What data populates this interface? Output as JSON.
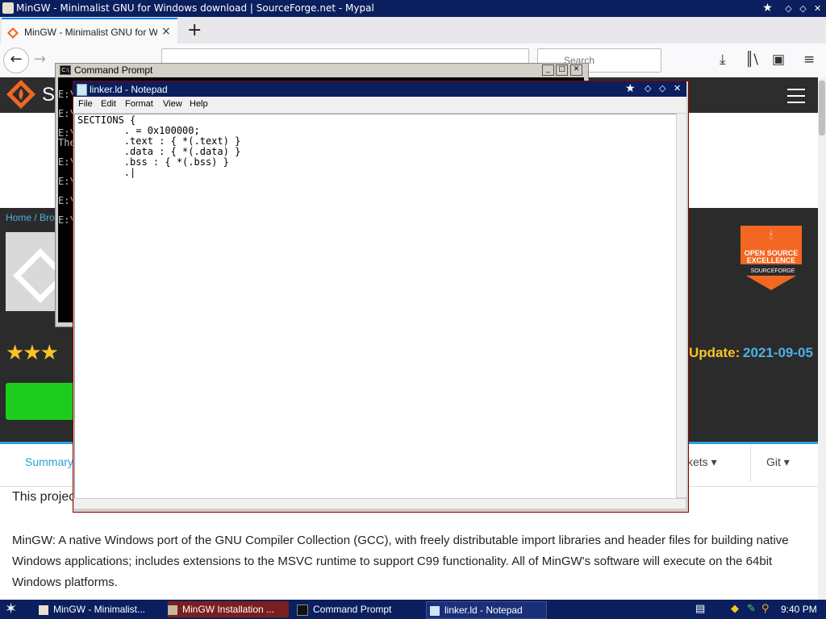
{
  "browser": {
    "window_title": "MinGW - Minimalist GNU for Windows download | SourceForge.net - Mypal",
    "tab": {
      "label": "MinGW - Minimalist GNU for Windo",
      "close_glyph": "×"
    },
    "new_tab_glyph": "+",
    "search_placeholder": "Search"
  },
  "page": {
    "logo_text": "S",
    "breadcrumb": "Home / Bro",
    "update_label": "Update:",
    "update_date": "2021-09-05",
    "badge": {
      "line1": "OPEN SOURCE",
      "line2": "EXCELLENCE",
      "brand": "SOURCEFORGE"
    },
    "tabs": {
      "summary": "Summary",
      "tickets": "kets ▾",
      "git": "Git ▾"
    },
    "intro": "This projec",
    "description": "MinGW: A native Windows port of the GNU Compiler Collection (GCC), with freely distributable import libraries and header files for building native Windows applications; includes extensions to the MSVC runtime to support C99 functionality. All of MinGW's software will execute on the 64bit Windows platforms."
  },
  "cmd": {
    "title": "Command Prompt",
    "icon_text": "C:\\",
    "lines": [
      "E:\\",
      "E:\\",
      "E:\\",
      "The",
      "E:\\",
      "E:\\",
      "E:\\",
      "E:\\"
    ]
  },
  "notepad": {
    "title": "linker.ld - Notepad",
    "menu": [
      "File",
      "Edit",
      "Format",
      "View",
      "Help"
    ],
    "content": "SECTIONS {\n        . = 0x100000;\n        .text : { *(.text) }\n        .data : { *(.data) }\n        .bss : { *(.bss) }\n        .|"
  },
  "taskbar": {
    "tasks": [
      "MinGW - Minimalist...",
      "MinGW Installation ...",
      "Command Prompt",
      "linker.ld - Notepad"
    ],
    "clock": "9:40 PM"
  },
  "colors": {
    "title_bar": "#0b1f5e",
    "sf_orange": "#f26722",
    "link_blue": "#2aa0d7",
    "star_yellow": "#f7c325",
    "download_green": "#1dcc1d"
  }
}
